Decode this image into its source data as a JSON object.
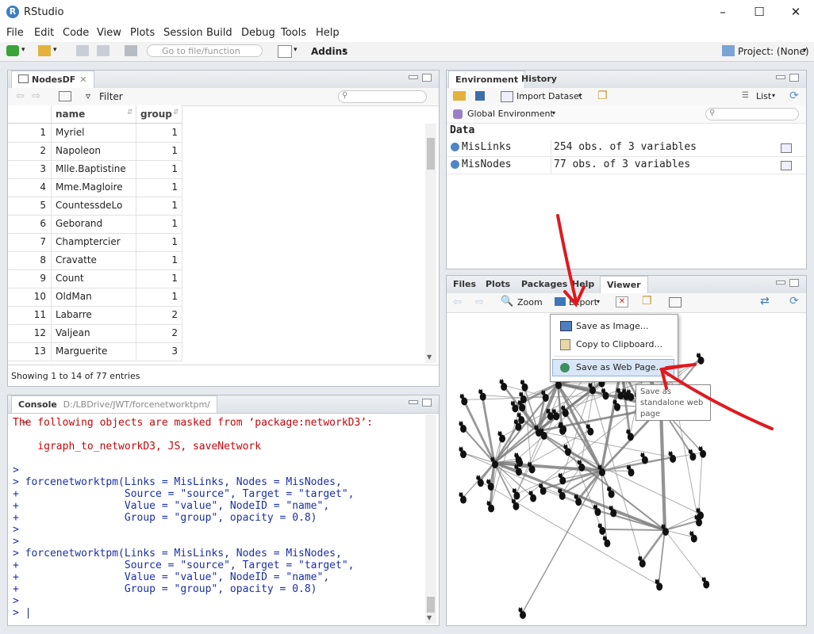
{
  "window": {
    "title": "RStudio",
    "logo": "R"
  },
  "menu": [
    "File",
    "Edit",
    "Code",
    "View",
    "Plots",
    "Session",
    "Build",
    "Debug",
    "Tools",
    "Help"
  ],
  "toolbar": {
    "goto_placeholder": "Go to file/function",
    "addins": "Addins",
    "project": "Project: (None)"
  },
  "data_viewer": {
    "tab": "NodesDF",
    "filter": "Filter",
    "columns": [
      "name",
      "group"
    ],
    "rows": [
      {
        "n": "1",
        "name": "Myriel",
        "group": "1"
      },
      {
        "n": "2",
        "name": "Napoleon",
        "group": "1"
      },
      {
        "n": "3",
        "name": "Mlle.Baptistine",
        "group": "1"
      },
      {
        "n": "4",
        "name": "Mme.Magloire",
        "group": "1"
      },
      {
        "n": "5",
        "name": "CountessdeLo",
        "group": "1"
      },
      {
        "n": "6",
        "name": "Geborand",
        "group": "1"
      },
      {
        "n": "7",
        "name": "Champtercier",
        "group": "1"
      },
      {
        "n": "8",
        "name": "Cravatte",
        "group": "1"
      },
      {
        "n": "9",
        "name": "Count",
        "group": "1"
      },
      {
        "n": "10",
        "name": "OldMan",
        "group": "1"
      },
      {
        "n": "11",
        "name": "Labarre",
        "group": "2"
      },
      {
        "n": "12",
        "name": "Valjean",
        "group": "2"
      },
      {
        "n": "13",
        "name": "Marguerite",
        "group": "3"
      }
    ],
    "footer": "Showing 1 to 14 of 77 entries"
  },
  "console": {
    "tab": "Console",
    "path": "D:/LBDrive/JWT/forcenetworktpm/",
    "lines": [
      {
        "text": "The following objects are masked from ‘package:networkD3’:",
        "color": "#c5060b"
      },
      {
        "text": "",
        "color": "#c5060b"
      },
      {
        "text": "    igraph_to_networkD3, JS, saveNetwork",
        "color": "#c5060b"
      },
      {
        "text": "",
        "color": "#c5060b"
      },
      {
        "text": "> ",
        "color": "#1b2fa8"
      },
      {
        "text": "> forcenetworktpm(Links = MisLinks, Nodes = MisNodes,",
        "color": "#1b2fa8"
      },
      {
        "text": "+                 Source = \"source\", Target = \"target\",",
        "color": "#1b2fa8"
      },
      {
        "text": "+                 Value = \"value\", NodeID = \"name\",",
        "color": "#1b2fa8"
      },
      {
        "text": "+                 Group = \"group\", opacity = 0.8)",
        "color": "#1b2fa8"
      },
      {
        "text": "> ",
        "color": "#1b2fa8"
      },
      {
        "text": "> ",
        "color": "#1b2fa8"
      },
      {
        "text": "> forcenetworktpm(Links = MisLinks, Nodes = MisNodes,",
        "color": "#1b2fa8"
      },
      {
        "text": "+                 Source = \"source\", Target = \"target\",",
        "color": "#1b2fa8"
      },
      {
        "text": "+                 Value = \"value\", NodeID = \"name\",",
        "color": "#1b2fa8"
      },
      {
        "text": "+                 Group = \"group\", opacity = 0.8)",
        "color": "#1b2fa8"
      },
      {
        "text": "> ",
        "color": "#1b2fa8"
      },
      {
        "text": "> |",
        "color": "#1b2fa8"
      }
    ]
  },
  "environment": {
    "tabs": [
      "Environment",
      "History"
    ],
    "import": "Import Dataset",
    "list": "List",
    "scope": "Global Environment",
    "section": "Data",
    "items": [
      {
        "name": "MisLinks",
        "value": "254 obs. of 3 variables"
      },
      {
        "name": "MisNodes",
        "value": "77 obs. of 3 variables"
      }
    ]
  },
  "viewer": {
    "tabs": [
      "Files",
      "Plots",
      "Packages",
      "Help",
      "Viewer"
    ],
    "zoom": "Zoom",
    "export": "Export",
    "menu": [
      "Save as Image...",
      "Copy to Clipboard...",
      "Save as Web Page..."
    ],
    "tooltip": [
      "Save as",
      "standalone web",
      "page"
    ]
  },
  "colors": {
    "console_red": "#c5060b",
    "console_blue": "#1b2fa8",
    "annotation_arrow": "#e0191e"
  }
}
